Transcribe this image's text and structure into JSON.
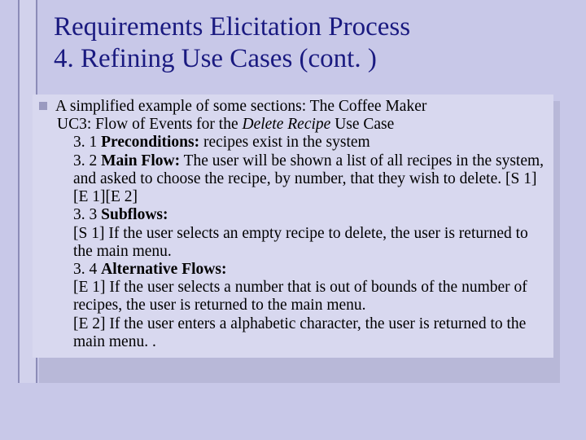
{
  "title_line1": "Requirements Elicitation Process",
  "title_line2": " 4. Refining Use Cases (cont. )",
  "intro": "A simplified example of some sections: The  Coffee Maker",
  "uc_prefix": "UC3:",
  "uc_rest": " Flow of Events for the ",
  "uc_italic": "Delete Recipe",
  "uc_after": " Use Case",
  "pre_num": "3. 1 ",
  "pre_label": "Preconditions:",
  "pre_text": " recipes exist in the system",
  "main_num": "3. 2 ",
  "main_label": "Main Flow:",
  "main_text": " The user will be shown a list of all recipes in the system, and asked to choose the recipe, by number, that they wish to delete. [S 1][E 1][E 2]",
  "sub_num": "3. 3 ",
  "sub_label": "Subflows:",
  "s1": "[S 1] If the user selects an empty recipe to delete, the user is returned to the main menu.",
  "alt_num": "3. 4 ",
  "alt_label": "Alternative Flows:",
  "e1": "[E 1] If the user selects a number that is out of bounds of the number of recipes, the user is returned to the main menu.",
  "e2": "[E 2] If the user enters a alphabetic character, the user is returned to the main menu. ."
}
